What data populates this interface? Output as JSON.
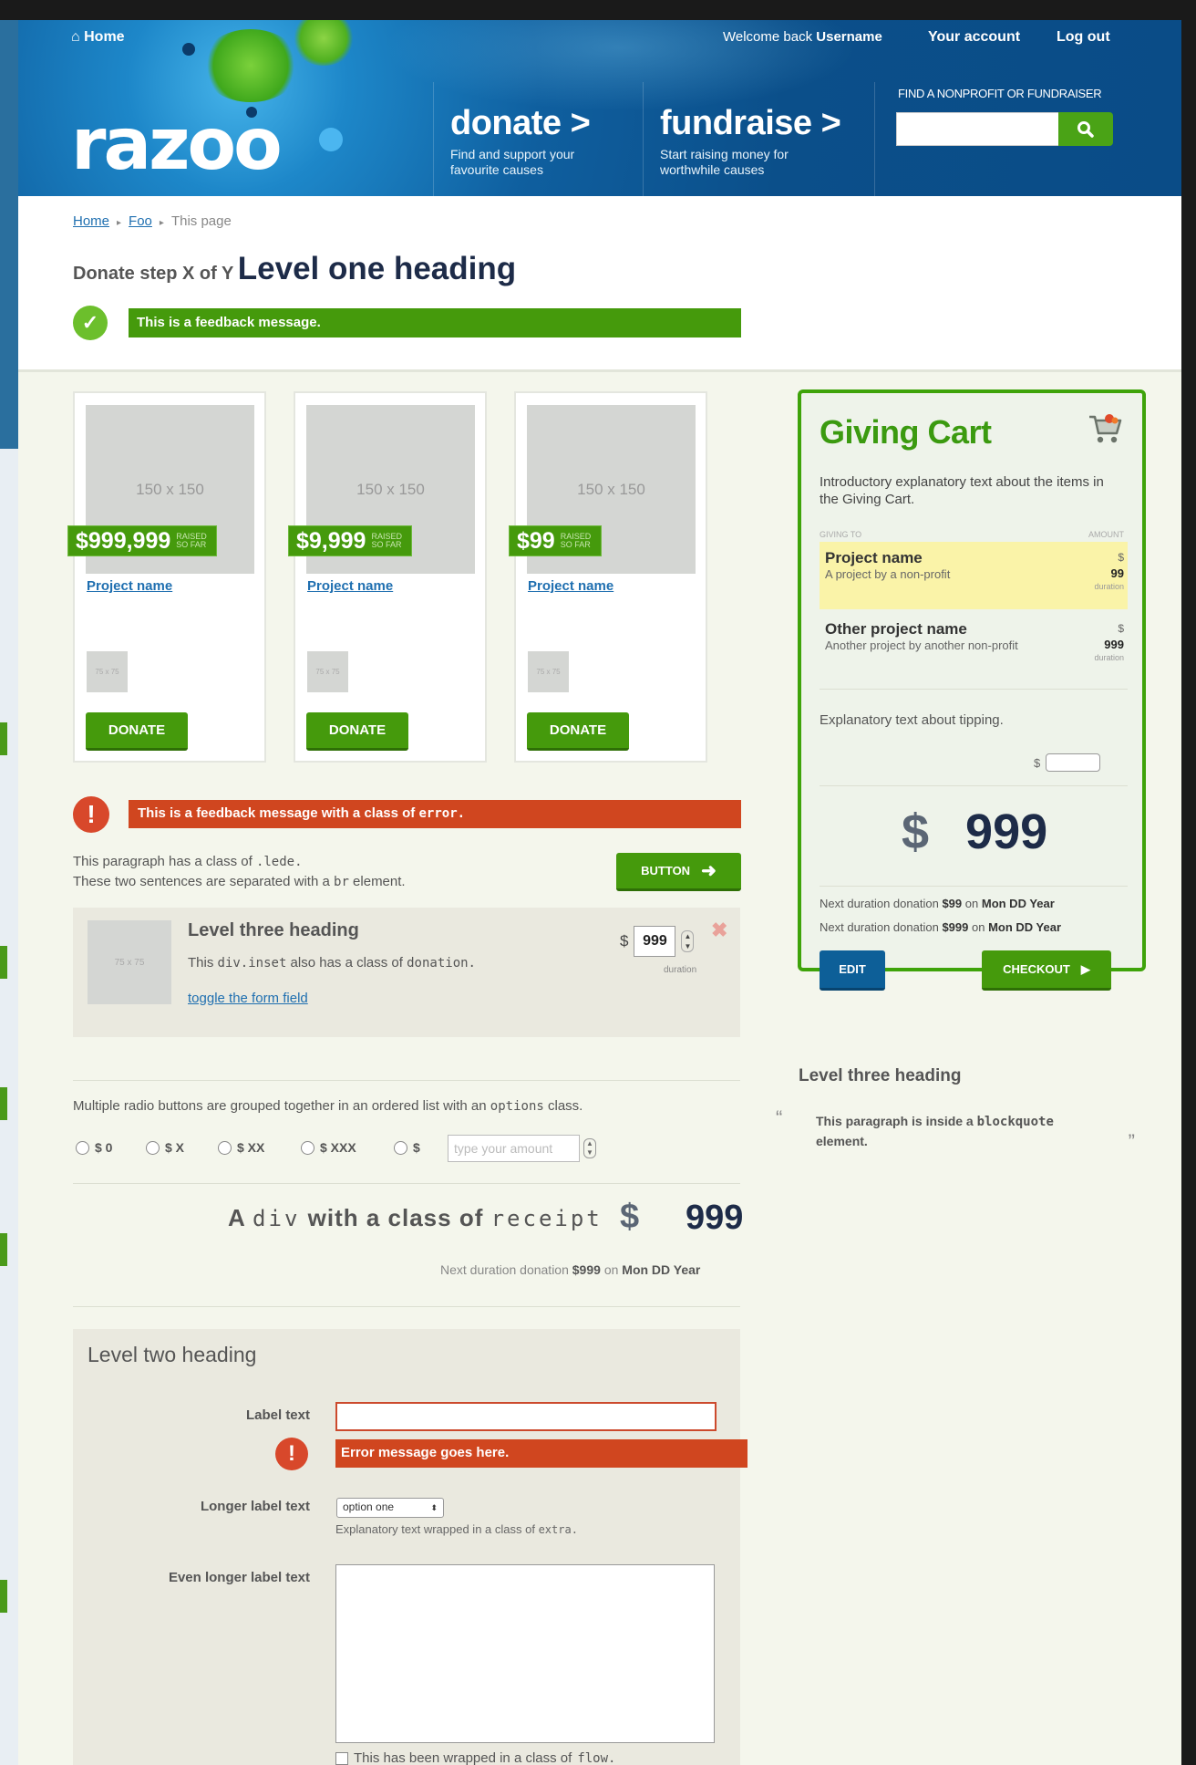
{
  "header": {
    "home": "Home",
    "welcome_pre": "Welcome back",
    "username": "Username",
    "account": "Your account",
    "logout": "Log out",
    "logo": "razoo",
    "donate": {
      "title": "donate >",
      "sub": "Find and support your favourite causes"
    },
    "fundraise": {
      "title": "fundraise >",
      "sub": "Start raising money for worthwhile causes"
    },
    "search_label": "FIND A NONPROFIT OR FUNDRAISER",
    "search_placeholder": "",
    "brand_color": "#459a0c"
  },
  "breadcrumb": [
    "Home",
    "Foo",
    "This page"
  ],
  "page": {
    "step": "Donate step X of Y",
    "heading": "Level one heading",
    "feedback": "This is a feedback message."
  },
  "projects": [
    {
      "img": "150 x 150",
      "raised": "$999,999",
      "raised_tag": "RAISED SO FAR",
      "name": "Project name",
      "thumb": "75 x 75",
      "donate": "DONATE"
    },
    {
      "img": "150 x 150",
      "raised": "$9,999",
      "raised_tag": "RAISED SO FAR",
      "name": "Project name",
      "thumb": "75 x 75",
      "donate": "DONATE"
    },
    {
      "img": "150 x 150",
      "raised": "$99",
      "raised_tag": "RAISED SO FAR",
      "name": "Project name",
      "thumb": "75 x 75",
      "donate": "DONATE"
    }
  ],
  "error_msg": {
    "pre": "This is a feedback message with a class of",
    "code": "error."
  },
  "lede": {
    "l1_pre": "This paragraph has a class of",
    "l1_code": ".lede.",
    "l2_pre": "These two sentences are separated with a",
    "l2_code": "br",
    "l2_post": "element."
  },
  "button_label": "BUTTON",
  "inset": {
    "thumb": "75 x 75",
    "heading": "Level three heading",
    "t_pre": "This",
    "t_code": "div.inset",
    "t_mid": "also has a class of",
    "t_code2": "donation.",
    "toggle": "toggle the form field",
    "currency": "$",
    "amount": "999",
    "duration": "duration"
  },
  "radios": {
    "intro_pre": "Multiple radio buttons are grouped together in an ordered list with an",
    "intro_code": "options",
    "intro_post": "class.",
    "options": [
      "$ 0",
      "$ X",
      "$ XX",
      "$ XXX",
      "$"
    ],
    "placeholder": "type your amount"
  },
  "receipt": {
    "pre": "A",
    "code": "div",
    "mid": "with a class of",
    "code2": "receipt",
    "currency": "$",
    "amount": "999",
    "next_pre": "Next duration donation",
    "next_amt": "$999",
    "next_on": "on",
    "next_date": "Mon DD Year"
  },
  "form": {
    "heading": "Level two heading",
    "label1": "Label text",
    "error": "Error message goes here.",
    "label2": "Longer label text",
    "select_value": "option one",
    "extra_pre": "Explanatory text wrapped in a class of",
    "extra_code": "extra.",
    "label3": "Even longer label text",
    "cb_pre": "This has been wrapped in a class of",
    "cb_code": "flow."
  },
  "cart": {
    "title": "Giving Cart",
    "intro": "Introductory explanatory text about the items in the Giving Cart.",
    "col_giving": "GIVING TO",
    "col_amount": "AMOUNT",
    "items": [
      {
        "name": "Project name",
        "desc": "A project by a non-profit",
        "cur": "$",
        "amt": "99",
        "dur": "duration"
      },
      {
        "name": "Other project name",
        "desc": "Another project by another non-profit",
        "cur": "$",
        "amt": "999",
        "dur": "duration"
      }
    ],
    "tip_text": "Explanatory text about tipping.",
    "tip_cur": "$",
    "total_cur": "$",
    "total": "999",
    "next1": {
      "pre": "Next duration donation",
      "amt": "$99",
      "on": "on",
      "date": "Mon DD Year"
    },
    "next2": {
      "pre": "Next duration donation",
      "amt": "$999",
      "on": "on",
      "date": "Mon DD Year"
    },
    "edit": "EDIT",
    "checkout": "CHECKOUT"
  },
  "sidebar": {
    "heading": "Level three heading",
    "quote_pre": "This paragraph is inside a",
    "quote_code": "blockquote",
    "quote_post": "element."
  }
}
